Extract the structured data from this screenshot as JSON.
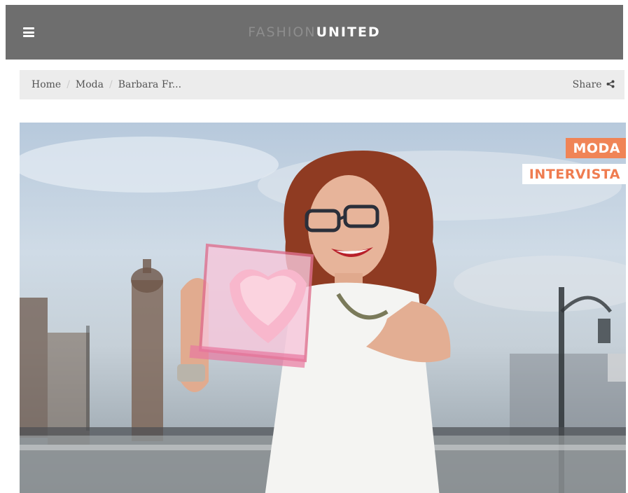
{
  "header": {
    "logo_light": "FASHION",
    "logo_bold": "UNITED"
  },
  "breadcrumb": {
    "items": [
      "Home",
      "Moda",
      "Barbara Fr..."
    ],
    "share_label": "Share"
  },
  "hero": {
    "tags": [
      "MODA",
      "INTERVISTA"
    ]
  },
  "colors": {
    "header_bg": "#6e6e6e",
    "breadcrumb_bg": "#ececec",
    "accent": "#f08456"
  },
  "icons": [
    "menu-icon",
    "share-icon"
  ]
}
